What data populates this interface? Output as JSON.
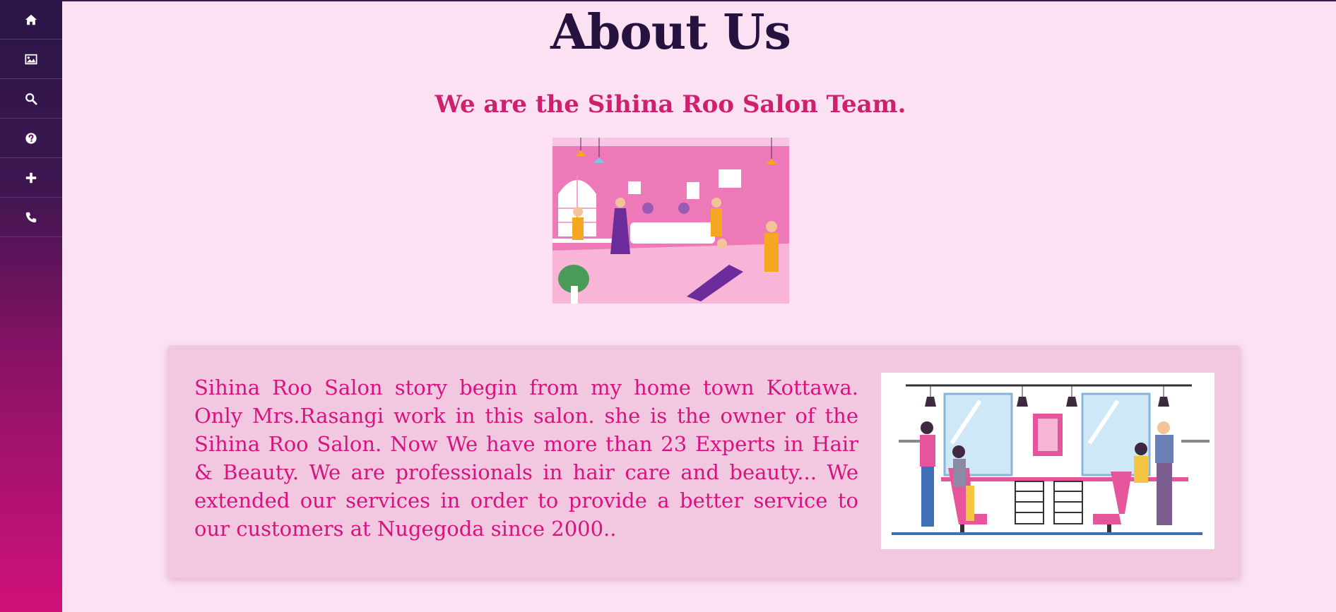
{
  "sidebar": {
    "items": [
      {
        "icon": "home-icon"
      },
      {
        "icon": "image-icon"
      },
      {
        "icon": "search-icon"
      },
      {
        "icon": "help-icon"
      },
      {
        "icon": "plus-icon"
      },
      {
        "icon": "phone-icon"
      }
    ]
  },
  "main": {
    "title": "About Us",
    "subtitle": "We are the Sihina Roo Salon Team.",
    "story": "Sihina Roo Salon story begin from my home town Kottawa. Only Mrs.Rasangi work in this salon. she is the owner of the Sihina Roo Salon. Now We have more than 23 Experts in Hair & Beauty. We are professionals in hair care and beauty... We extended our services in order to provide a better service to our customers at Nugegoda since 2000.."
  },
  "colors": {
    "page_bg": "#fce1f3",
    "title": "#25123f",
    "subtitle": "#cf1f6f",
    "story_text": "#d8137f",
    "card_bg": "#f2c8e1",
    "sidebar_top": "#2a1547",
    "sidebar_bottom": "#d0117a"
  }
}
